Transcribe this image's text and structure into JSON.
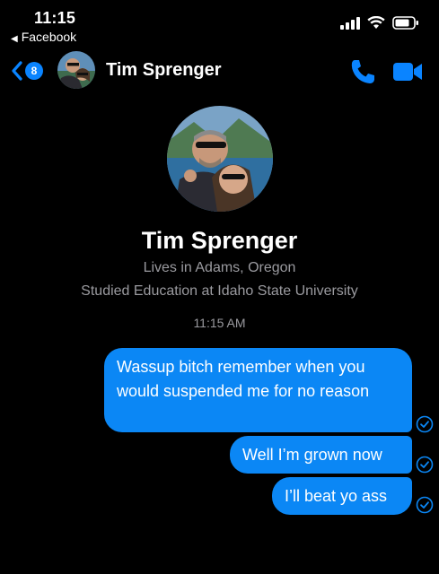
{
  "status_bar": {
    "time": "11:15",
    "back_app": "Facebook"
  },
  "header": {
    "back_badge": "8",
    "contact_name": "Tim Sprenger",
    "accent_color": "#0a84ff"
  },
  "profile": {
    "name": "Tim Sprenger",
    "lives": "Lives in Adams, Oregon",
    "studied": "Studied Education at Idaho State University"
  },
  "conversation": {
    "timestamp": "11:15 AM",
    "messages": [
      {
        "text": "Wassup bitch remember when you would suspended me for no reason",
        "status": "sent-check-icon"
      },
      {
        "text": "Well I’m grown now",
        "status": "sent-check-icon"
      },
      {
        "text": "I’ll beat yo ass",
        "status": "sent-check-icon"
      }
    ]
  }
}
